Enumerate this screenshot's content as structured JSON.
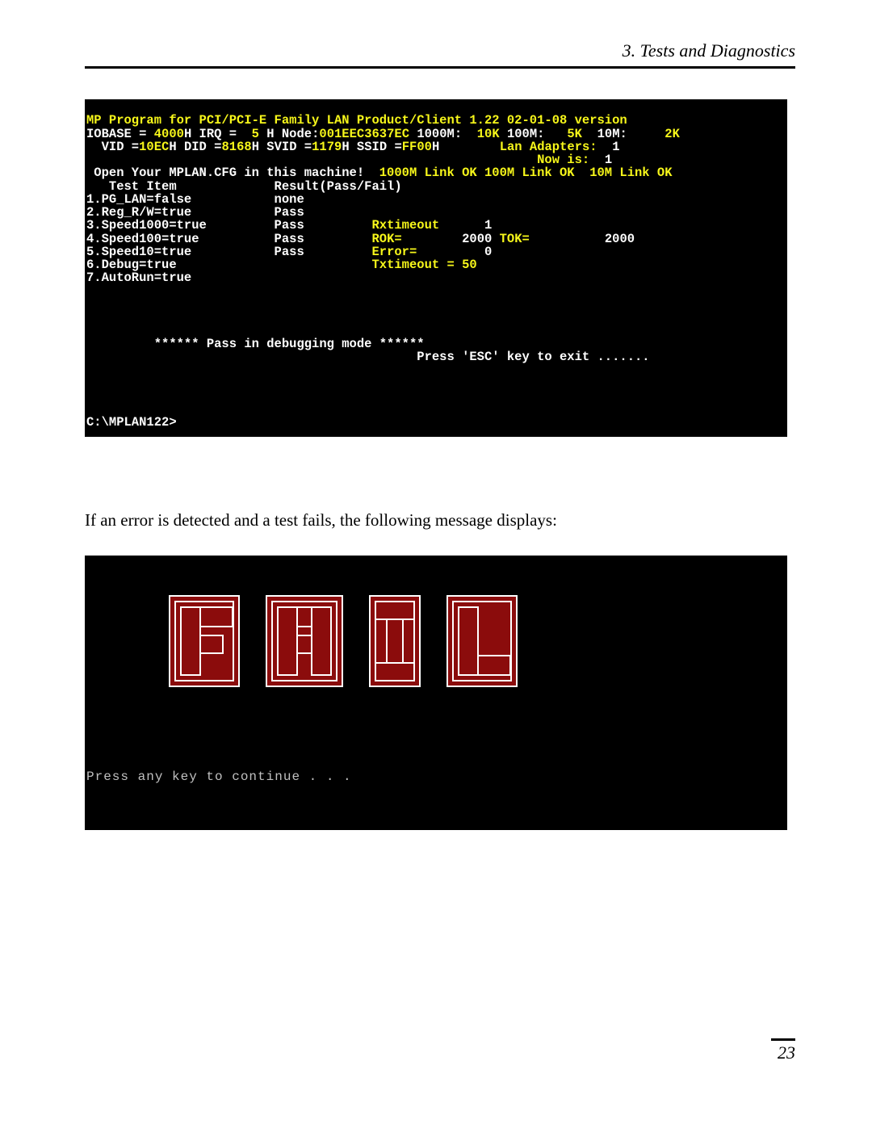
{
  "header": {
    "title": "3.  Tests and Diagnostics"
  },
  "terminal1": {
    "title": "MP Program for PCI/PCI-E Family LAN Product/Client 1.22 02-01-08 version",
    "iobase_line": {
      "lbl_iobase": "IOBASE = ",
      "iobase": "4000",
      "lbl_hirq": "H IRQ =  ",
      "irq": "5",
      "lbl_node": " H Node:",
      "node": "001EEC3637EC",
      "sp1000m": " 1000M:",
      "v10k": "  10K",
      "sp100m": " 100M:",
      "v5k": "   5K",
      "sp10m": "  10M:",
      "v2k": "     2K"
    },
    "vid_line": {
      "lbl_vid": "  VID =",
      "vid": "10EC",
      "lbl_did": "H DID =",
      "did": "8168",
      "lbl_svid": "H SVID =",
      "svid": "1179",
      "lbl_ssid": "H SSID =",
      "ssid": "FF00",
      "h_trail": "H        ",
      "lan_adapters_lbl": "Lan Adapters:  ",
      "lan_adapters": "1"
    },
    "now_line": {
      "lbl": "Now is:  ",
      "val": "1"
    },
    "open_cfg": " Open Your MPLAN.CFG in this machine!",
    "links": "  1000M Link OK 100M Link OK  10M Link OK",
    "columns_header": "   Test Item             Result(Pass/Fail)",
    "tests": [
      {
        "item": "1.PG_LAN=false",
        "result": "none"
      },
      {
        "item": "2.Reg_R/W=true",
        "result": "Pass"
      },
      {
        "item": "3.Speed1000=true",
        "result": "Pass",
        "extra_lbl": "Rxtimeout",
        "extra_val": "      1"
      },
      {
        "item": "4.Speed100=true",
        "result": "Pass",
        "extra_lbl": "ROK=",
        "extra_val": "        2000",
        "extra2_lbl": " TOK=",
        "extra2_val": "          2000"
      },
      {
        "item": "5.Speed10=true",
        "result": "Pass",
        "extra_lbl": "Error=",
        "extra_val": "         0"
      },
      {
        "item": "6.Debug=true",
        "result": "",
        "extra_lbl": "Txtimeout = 50"
      },
      {
        "item": "7.AutoRun=true",
        "result": ""
      }
    ],
    "pass_line": "         ****** Pass in debugging mode ******",
    "press_esc": "                                            Press 'ESC' key to exit .......",
    "prompt": "C:\\MPLAN122>"
  },
  "body_text": "If an error is detected and a test fails, the following message displays:",
  "terminal2": {
    "fail_text": "FAIL",
    "continue_text": "Press any key to continue . . ."
  },
  "footer": {
    "page_number": "23"
  }
}
